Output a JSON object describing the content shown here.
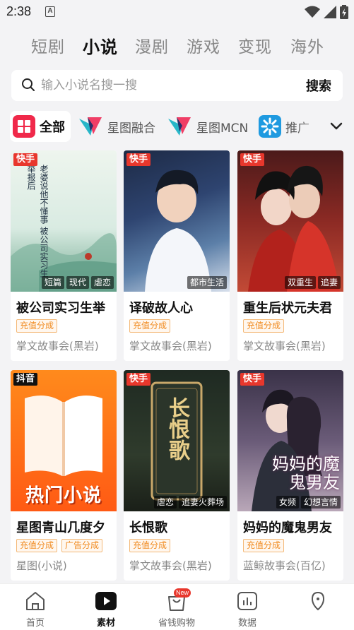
{
  "status": {
    "time": "2:38"
  },
  "top_tabs": [
    {
      "label": "短剧",
      "active": false
    },
    {
      "label": "小说",
      "active": true
    },
    {
      "label": "漫剧",
      "active": false
    },
    {
      "label": "游戏",
      "active": false
    },
    {
      "label": "变现",
      "active": false
    },
    {
      "label": "海外",
      "active": false
    }
  ],
  "search": {
    "placeholder": "输入小说名搜一搜",
    "button_label": "搜索"
  },
  "categories": [
    {
      "label": "全部",
      "icon": "grid-icon",
      "active": true
    },
    {
      "label": "星图融合",
      "icon": "xingtu-logo-icon",
      "active": false
    },
    {
      "label": "星图MCN",
      "icon": "xingtu-logo-icon",
      "active": false
    },
    {
      "label": "推广",
      "icon": "promo-icon",
      "active": false
    }
  ],
  "books": [
    {
      "platform": "快手",
      "tags": [
        "短篇",
        "现代",
        "虐恋"
      ],
      "title": "被公司实习生举",
      "badges": [
        "充值分成"
      ],
      "publisher": "掌文故事会(黑岩)",
      "cover_text": "老婆说他不懂事  被公司实习生举报后"
    },
    {
      "platform": "快手",
      "tags": [
        "都市生活"
      ],
      "title": "译破故人心",
      "badges": [
        "充值分成"
      ],
      "publisher": "掌文故事会(黑岩)"
    },
    {
      "platform": "快手",
      "tags": [
        "双重生",
        "追妻"
      ],
      "title": "重生后状元夫君",
      "badges": [
        "充值分成"
      ],
      "publisher": "掌文故事会(黑岩)"
    },
    {
      "platform": "抖音",
      "tags": [],
      "title": "星图青山几度夕",
      "badges": [
        "充值分成",
        "广告分成"
      ],
      "publisher": "星图(小说)",
      "cover_text": "热门小说"
    },
    {
      "platform": "快手",
      "tags": [
        "虐恋",
        "追妻火葬场"
      ],
      "title": "长恨歌",
      "badges": [
        "充值分成"
      ],
      "publisher": "掌文故事会(黑岩)",
      "cover_text": "长恨歌"
    },
    {
      "platform": "快手",
      "tags": [
        "女频",
        "幻想言情"
      ],
      "title": "妈妈的魔鬼男友",
      "badges": [
        "充值分成"
      ],
      "publisher": "蓝鲸故事会(百亿)",
      "cover_text": "妈妈的魔鬼男友"
    }
  ],
  "bottom_nav": [
    {
      "label": "首页",
      "icon": "home-icon",
      "active": false
    },
    {
      "label": "素材",
      "icon": "play-icon",
      "active": true
    },
    {
      "label": "省钱购物",
      "icon": "shopping-bag-icon",
      "active": false,
      "badge": "New"
    },
    {
      "label": "数据",
      "icon": "bar-chart-icon",
      "active": false
    },
    {
      "label": "",
      "icon": "profile-icon",
      "active": false
    }
  ],
  "colors": {
    "accent": "#e8372c",
    "badge_orange": "#f08a1f",
    "background": "#f3f3f5"
  }
}
